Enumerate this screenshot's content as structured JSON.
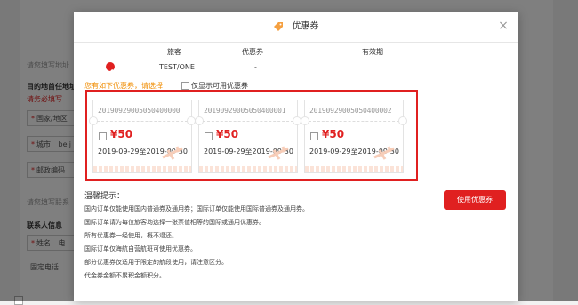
{
  "background": {
    "hint1": "请您填写地址",
    "dest_label": "目的地首任地址",
    "warn": "请务必填写",
    "country_label": "国家/地区",
    "city_label": "城市",
    "city_value": "beij",
    "postal_label": "邮政编码",
    "hint2": "请您填写联系",
    "contact_heading": "联系人信息",
    "name_label": "姓名",
    "name_value": "电",
    "phone_label": "固定电话"
  },
  "modal": {
    "title": "优惠券",
    "close_symbol": "×",
    "columns": [
      "旅客",
      "优惠券",
      "有效期"
    ],
    "row": {
      "passenger": "TEST/ONE",
      "coupon": "-",
      "validity": ""
    },
    "available_hint": "您有如下优惠券，请选择",
    "only_available_label": "仅显示可用优惠券",
    "coupons": [
      {
        "code": "20190929005050400000",
        "amount": "¥50",
        "validity": "2019-09-29至2019-09-30"
      },
      {
        "code": "20190929005050400001",
        "amount": "¥50",
        "validity": "2019-09-29至2019-09-30"
      },
      {
        "code": "20190929005050400002",
        "amount": "¥50",
        "validity": "2019-09-29至2019-09-30"
      }
    ],
    "notes_title": "温馨提示：",
    "notes": [
      "国内订单仅能使用国内普通券及通用券；国际订单仅能使用国际普通券及通用券。",
      "国际订单请为每位旅客均选择一张票值相等的国际或通用优惠券。",
      "所有优惠券一经使用，概不退还。",
      "国际订单仅海航自营航班可使用优惠券。",
      "部分优惠券仅适用于限定的航段使用，请注意区分。",
      "代金券金额不累积金额积分。"
    ],
    "use_button": "使用优惠券"
  },
  "colors": {
    "accent": "#e02020",
    "hint": "#f08c00",
    "overlay": "rgba(0,0,0,0.5)"
  }
}
